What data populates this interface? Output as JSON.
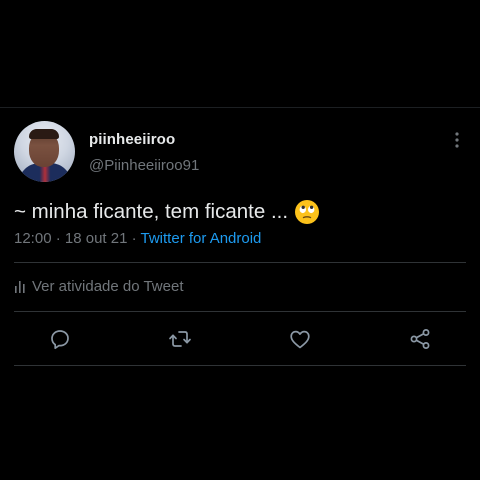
{
  "tweet": {
    "author": {
      "display_name": "piinheeiiroo",
      "handle": "@Piinheeiiroo91",
      "avatar_icon": "profile-photo"
    },
    "text": "~ minha ficante, tem ficante ...",
    "emoji": "rolling-eyes-emoji",
    "meta": {
      "time": "12:00",
      "sep1": " · ",
      "date": "18 out 21",
      "sep2": " · ",
      "source": "Twitter for Android"
    },
    "activity_label": "Ver atividade do Tweet",
    "actions": [
      "reply-icon",
      "retweet-icon",
      "like-icon",
      "share-icon"
    ]
  },
  "colors": {
    "background": "#000000",
    "primary_text": "#e7e9ea",
    "secondary_text": "#71767b",
    "link": "#1d9bf0",
    "divider": "#2f3336"
  }
}
